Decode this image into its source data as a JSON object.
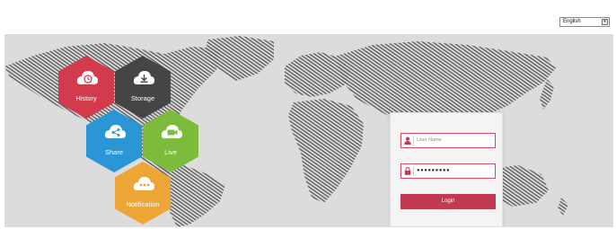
{
  "language": {
    "selected": "English"
  },
  "hexes": [
    {
      "label": "History",
      "icon": "history-cloud-icon",
      "color": "#d43a4e"
    },
    {
      "label": "Storage",
      "icon": "storage-download-icon",
      "color": "#454545"
    },
    {
      "label": "Share",
      "icon": "share-cloud-icon",
      "color": "#2a96d6"
    },
    {
      "label": "Live",
      "icon": "live-video-icon",
      "color": "#7dbb3c"
    },
    {
      "label": "Notification",
      "icon": "notification-chat-icon",
      "color": "#eda635"
    }
  ],
  "login": {
    "username_placeholder": "User Name",
    "password_value": "●●●●●●●●●",
    "button_label": "Login",
    "accent": "#c23a50"
  },
  "colors": {
    "background": "#dcdcdc",
    "map_stripes": "#5f5f5f"
  }
}
